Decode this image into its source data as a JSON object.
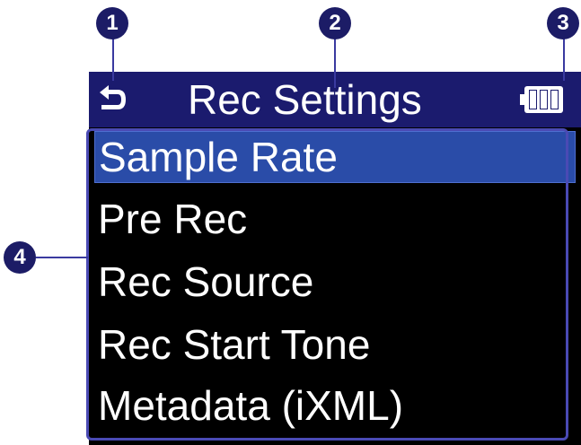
{
  "screen": {
    "title": "Rec Settings",
    "icons": {
      "back": "back-arrow-icon",
      "battery": "battery-icon"
    }
  },
  "menu": {
    "items": [
      {
        "label": "Sample Rate",
        "selected": true
      },
      {
        "label": "Pre Rec",
        "selected": false
      },
      {
        "label": "Rec Source",
        "selected": false
      },
      {
        "label": "Rec Start Tone",
        "selected": false
      },
      {
        "label": "Metadata (iXML)",
        "selected": false
      }
    ]
  },
  "callouts": [
    "1",
    "2",
    "3",
    "4"
  ],
  "colors": {
    "header_bg": "#1b1b6e",
    "selection": "#2a4ca8",
    "screen_bg": "#000000",
    "callout": "#1c1c66"
  }
}
